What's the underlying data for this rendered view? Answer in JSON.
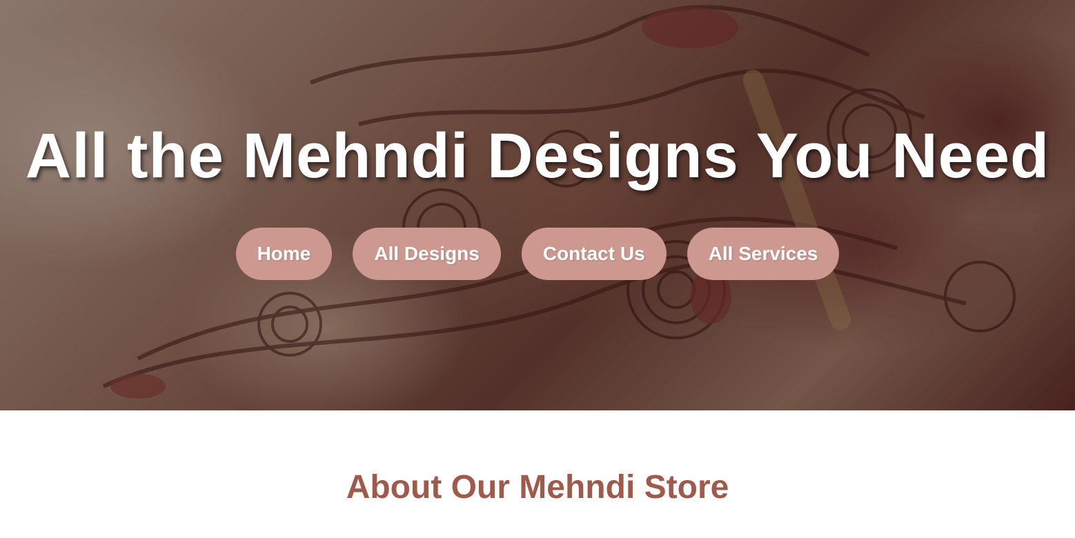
{
  "hero": {
    "title": "All the Mehndi Designs You Need",
    "background_image": "mehndi-hands-photo"
  },
  "nav": {
    "items": [
      {
        "label": "Home"
      },
      {
        "label": "All Designs"
      },
      {
        "label": "Contact Us"
      },
      {
        "label": "All Services"
      }
    ]
  },
  "about": {
    "title": "About Our Mehndi Store"
  },
  "colors": {
    "nav_button_bg": "#cc9890",
    "nav_button_text": "#ffffff",
    "hero_title": "#ffffff",
    "about_title": "#a05a4c"
  }
}
